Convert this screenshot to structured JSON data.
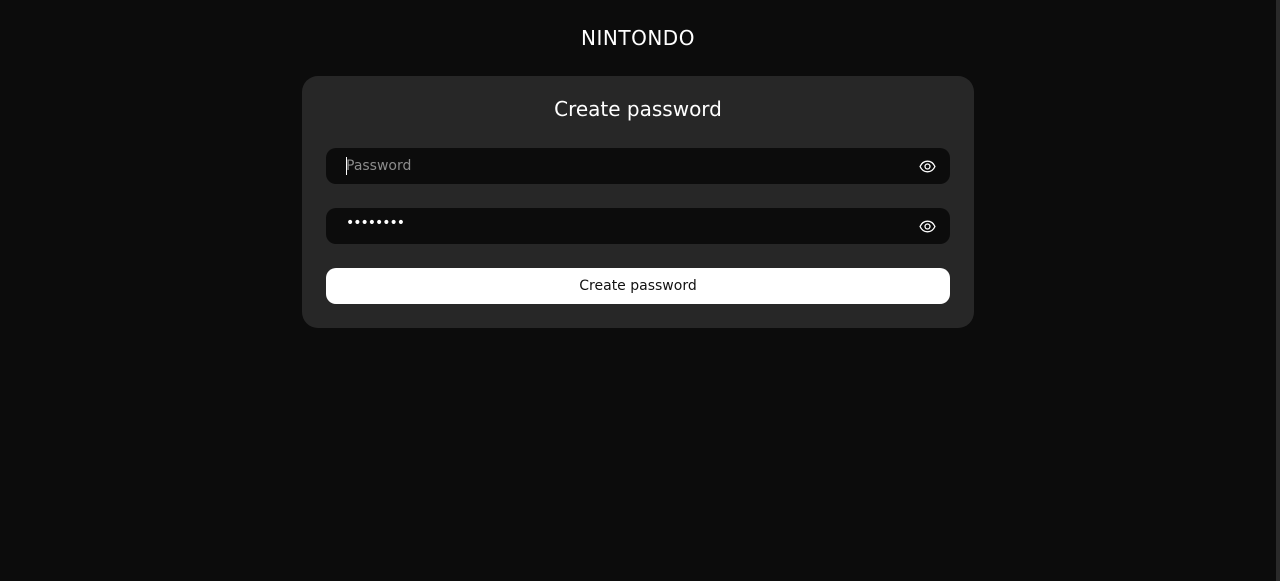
{
  "header": {
    "brand": "NINTONDO"
  },
  "form": {
    "title": "Create password",
    "password": {
      "placeholder": "Password",
      "value": ""
    },
    "confirm": {
      "value": "••••••••"
    },
    "submit_label": "Create password"
  },
  "icons": {
    "eye": "eye-icon"
  },
  "colors": {
    "background": "#0c0c0c",
    "card": "#272727",
    "button": "#ffffff"
  }
}
